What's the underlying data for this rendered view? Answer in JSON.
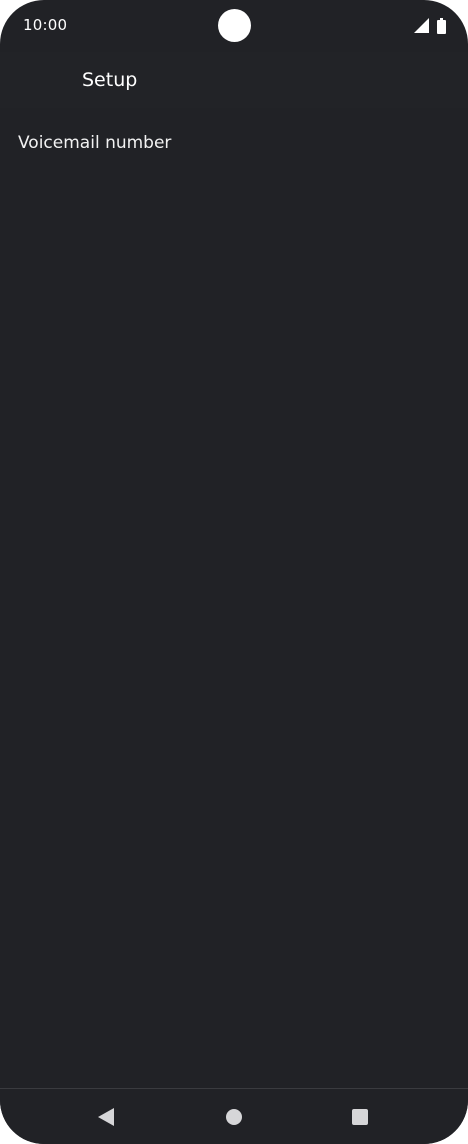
{
  "status_bar": {
    "time": "10:00",
    "icons": [
      "signal-icon",
      "battery-icon"
    ]
  },
  "app_bar": {
    "title": "Setup"
  },
  "settings": {
    "items": [
      {
        "label": "Voicemail number"
      }
    ]
  },
  "navigation": {
    "buttons": [
      "back-icon",
      "home-icon",
      "recents-icon"
    ]
  },
  "colors": {
    "background": "#212226",
    "text": "#ffffff"
  }
}
